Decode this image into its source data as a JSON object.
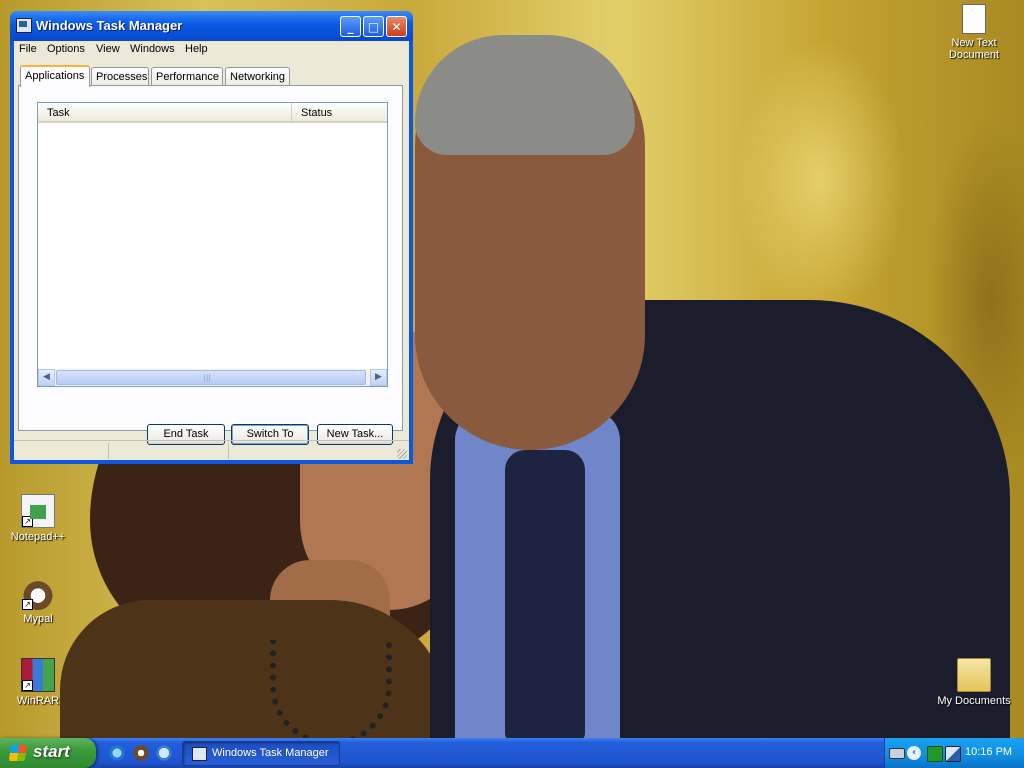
{
  "window": {
    "title": "Windows Task Manager",
    "controls": {
      "minimize": "_",
      "maximize": "□",
      "close": "✕"
    },
    "menu": [
      "File",
      "Options",
      "View",
      "Windows",
      "Help"
    ],
    "tabs": [
      {
        "label": "Applications",
        "active": true
      },
      {
        "label": "Processes",
        "active": false
      },
      {
        "label": "Performance",
        "active": false
      },
      {
        "label": "Networking",
        "active": false
      }
    ],
    "list": {
      "columns": [
        "Task",
        "Status"
      ],
      "rows": []
    },
    "buttons": {
      "end_task": "End Task",
      "switch_to": "Switch To",
      "new_task": "New Task..."
    }
  },
  "desktop_icons": {
    "new_text_document": "New Text Document",
    "notepad_pp": "Notepad++",
    "mypal": "Mypal",
    "winrar": "WinRAR",
    "my_documents": "My Documents"
  },
  "taskbar": {
    "start_label": "start",
    "task_button": "Windows Task Manager",
    "clock": "10:16 PM",
    "tray_chevron": "‹"
  },
  "colors": {
    "taskbar_blue": "#245edb",
    "start_green": "#3c9a3c",
    "window_blue": "#0a58e2",
    "dialog_gray": "#ece9d8"
  }
}
